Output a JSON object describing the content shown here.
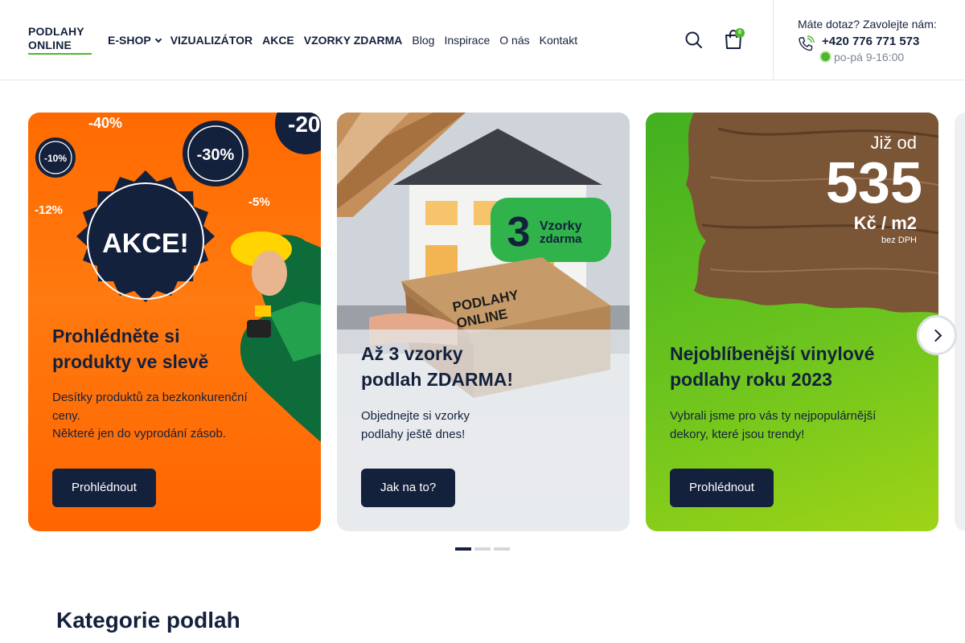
{
  "header": {
    "logo_line1": "PODLAHY",
    "logo_line2": "ONLINE",
    "nav": [
      {
        "label": "E-SHOP"
      },
      {
        "label": "VIZUALIZÁTOR"
      },
      {
        "label": "AKCE"
      },
      {
        "label": "VZORKY ZDARMA"
      },
      {
        "label": "Blog"
      },
      {
        "label": "Inspirace"
      },
      {
        "label": "O nás"
      },
      {
        "label": "Kontakt"
      }
    ],
    "cart_count": "0",
    "contact_question": "Máte dotaz? Zavolejte nám:",
    "phone": "+420 776 771 573",
    "hours": "po-pá 9-16:00"
  },
  "slides": [
    {
      "title": "Prohlédněte si\nprodukty ve slevě",
      "text": "Desítky produktů za bezkonkurenční\nceny.\nNěkteré jen do vyprodání zásob.",
      "button": "Prohlédnout",
      "art": {
        "badge_main": "AKCE!",
        "discounts": [
          "-40%",
          "-30%",
          "-10%",
          "-12%",
          "-5%",
          "-20"
        ]
      }
    },
    {
      "title": "Až 3 vzorky\npodlah ZDARMA!",
      "text": "Objednejte si vzorky\npodlahy ještě dnes!",
      "button": "Jak na to?",
      "art": {
        "sticker_number": "3",
        "sticker_line1": "Vzorky",
        "sticker_line2": "zdarma",
        "box_line1": "PODLAHY",
        "box_line2": "ONLINE"
      }
    },
    {
      "title": "Nejoblíbenější vinylové\npodlahy roku 2023",
      "text": "Vybrali jsme pro vás ty nejpopulárnější\ndekory, které jsou trendy!",
      "button": "Prohlédnout",
      "art": {
        "price_prefix": "Již od",
        "price": "535",
        "unit": "Kč / m2",
        "note": "bez DPH"
      }
    }
  ],
  "slider": {
    "active_index": 0,
    "dot_count": 3
  },
  "section": {
    "title": "Kategorie podlah"
  },
  "colors": {
    "navy": "#14213d",
    "green": "#4cb72a",
    "orange": "#ff6a00"
  }
}
